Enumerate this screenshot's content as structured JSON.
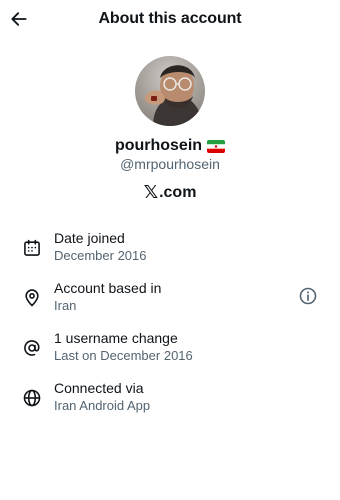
{
  "header": {
    "title": "About this account",
    "back_icon": "arrow-left-icon"
  },
  "profile": {
    "name": "pourhosein",
    "flag_icon": "iran-flag-icon",
    "handle": "@mrpourhosein",
    "domain_symbol": "𝕏",
    "domain_text": ".com"
  },
  "details": [
    {
      "icon": "calendar-icon",
      "label": "Date joined",
      "value": "December 2016"
    },
    {
      "icon": "location-pin-icon",
      "label": "Account based in",
      "value": "Iran",
      "trailing_icon": "info-icon"
    },
    {
      "icon": "at-sign-icon",
      "label": "1 username change",
      "value": "Last on December 2016"
    },
    {
      "icon": "globe-icon",
      "label": "Connected via",
      "value": "Iran Android App"
    }
  ],
  "colors": {
    "text_primary": "#0f1419",
    "text_secondary": "#536471",
    "background": "#ffffff",
    "flag_green": "#239f40",
    "flag_red": "#da0000"
  }
}
